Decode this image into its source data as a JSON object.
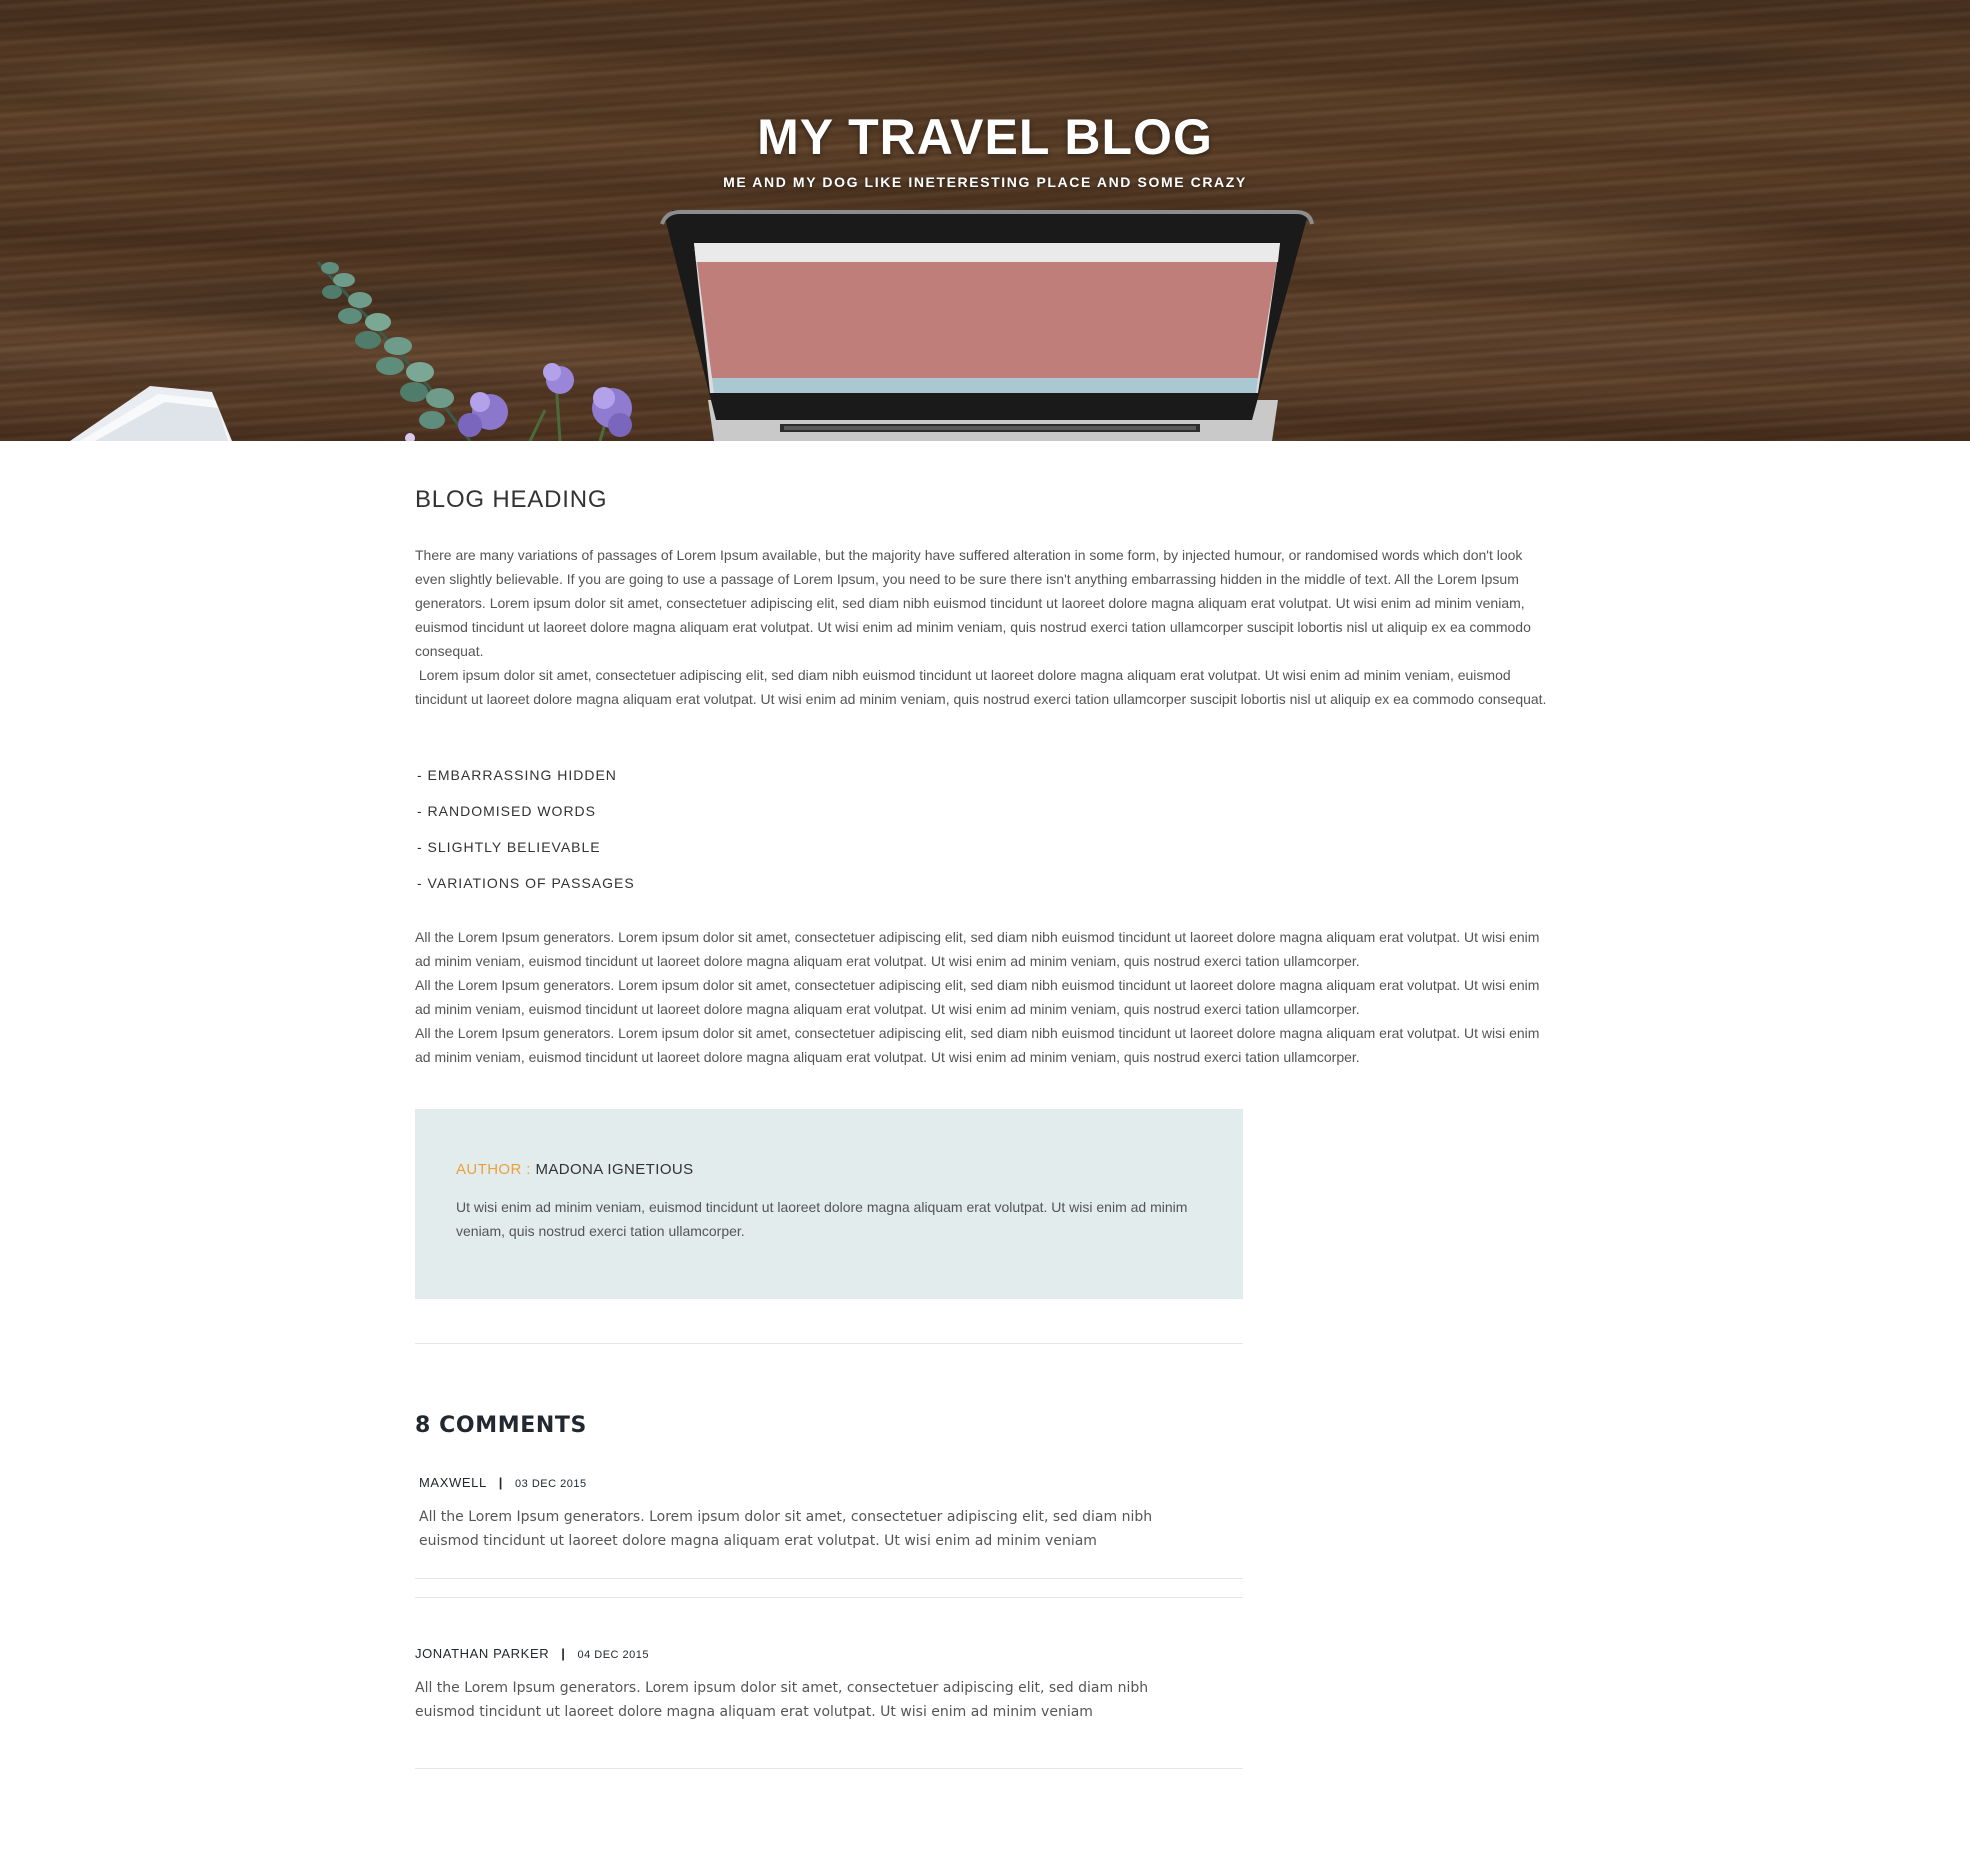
{
  "hero": {
    "title": "MY TRAVEL BLOG",
    "subtitle": "ME AND MY DOG LIKE INETERESTING PLACE AND SOME CRAZY"
  },
  "article": {
    "heading": "BLOG HEADING",
    "intro_paragraph": "There are many variations of passages of Lorem Ipsum available, but the majority have suffered alteration in some form, by injected humour, or randomised words which don't look even slightly believable. If you are going to use a passage of Lorem Ipsum, you need to be sure there isn't anything embarrassing hidden in the middle of text. All the Lorem Ipsum generators. Lorem ipsum dolor sit amet, consectetuer adipiscing elit, sed diam nibh euismod tincidunt ut laoreet dolore magna aliquam erat volutpat. Ut wisi enim ad minim veniam, euismod tincidunt ut laoreet dolore magna aliquam erat volutpat. Ut wisi enim ad minim veniam, quis nostrud exerci tation ullamcorper suscipit lobortis nisl ut aliquip ex ea commodo consequat.",
    "second_paragraph": " Lorem ipsum dolor sit amet, consectetuer adipiscing elit, sed diam nibh euismod tincidunt ut laoreet dolore magna aliquam erat volutpat. Ut wisi enim ad minim veniam, euismod tincidunt ut laoreet dolore magna aliquam erat volutpat. Ut wisi enim ad minim veniam, quis nostrud exerci tation ullamcorper suscipit lobortis nisl ut aliquip ex ea commodo consequat.",
    "list_items": [
      "- EMBARRASSING HIDDEN",
      "- RANDOMISED WORDS",
      "- SLIGHTLY BELIEVABLE",
      "- VARIATIONS OF PASSAGES"
    ],
    "generator_paragraphs": [
      "All the Lorem Ipsum generators. Lorem ipsum dolor sit amet, consectetuer adipiscing elit, sed diam nibh euismod tincidunt ut laoreet dolore magna aliquam erat volutpat. Ut wisi enim ad minim veniam, euismod tincidunt ut laoreet dolore magna aliquam erat volutpat. Ut wisi enim ad minim veniam, quis nostrud exerci tation ullamcorper.",
      "All the Lorem Ipsum generators. Lorem ipsum dolor sit amet, consectetuer adipiscing elit, sed diam nibh euismod tincidunt ut laoreet dolore magna aliquam erat volutpat. Ut wisi enim ad minim veniam, euismod tincidunt ut laoreet dolore magna aliquam erat volutpat. Ut wisi enim ad minim veniam, quis nostrud exerci tation ullamcorper.",
      "All the Lorem Ipsum generators. Lorem ipsum dolor sit amet, consectetuer adipiscing elit, sed diam nibh euismod tincidunt ut laoreet dolore magna aliquam erat volutpat. Ut wisi enim ad minim veniam, euismod tincidunt ut laoreet dolore magna aliquam erat volutpat. Ut wisi enim ad minim veniam, quis nostrud exerci tation ullamcorper."
    ]
  },
  "author": {
    "label": "AUTHOR : ",
    "name": "MADONA IGNETIOUS",
    "bio": "Ut wisi enim ad minim veniam, euismod tincidunt ut laoreet dolore magna aliquam erat volutpat. Ut wisi enim ad minim veniam, quis nostrud exerci tation ullamcorper.",
    "label_color": "#e8a13c",
    "box_color": "#e2ecec"
  },
  "comments": {
    "heading": "8 COMMENTS",
    "separator": "|",
    "items": [
      {
        "author": "MAXWELL",
        "date": "03 DEC 2015",
        "text": "All the Lorem Ipsum generators. Lorem ipsum dolor sit amet, consectetuer adipiscing elit, sed diam nibh euismod tincidunt ut laoreet dolore magna aliquam erat volutpat. Ut wisi enim ad minim veniam"
      },
      {
        "author": "JONATHAN PARKER",
        "date": "04 DEC 2015",
        "text": "All the Lorem Ipsum generators. Lorem ipsum dolor sit amet, consectetuer adipiscing elit, sed diam nibh euismod tincidunt ut laoreet dolore magna aliquam erat volutpat. Ut wisi enim ad minim veniam"
      }
    ]
  },
  "icons": {
    "hero_image": "laptop-on-wooden-desk-photo"
  }
}
